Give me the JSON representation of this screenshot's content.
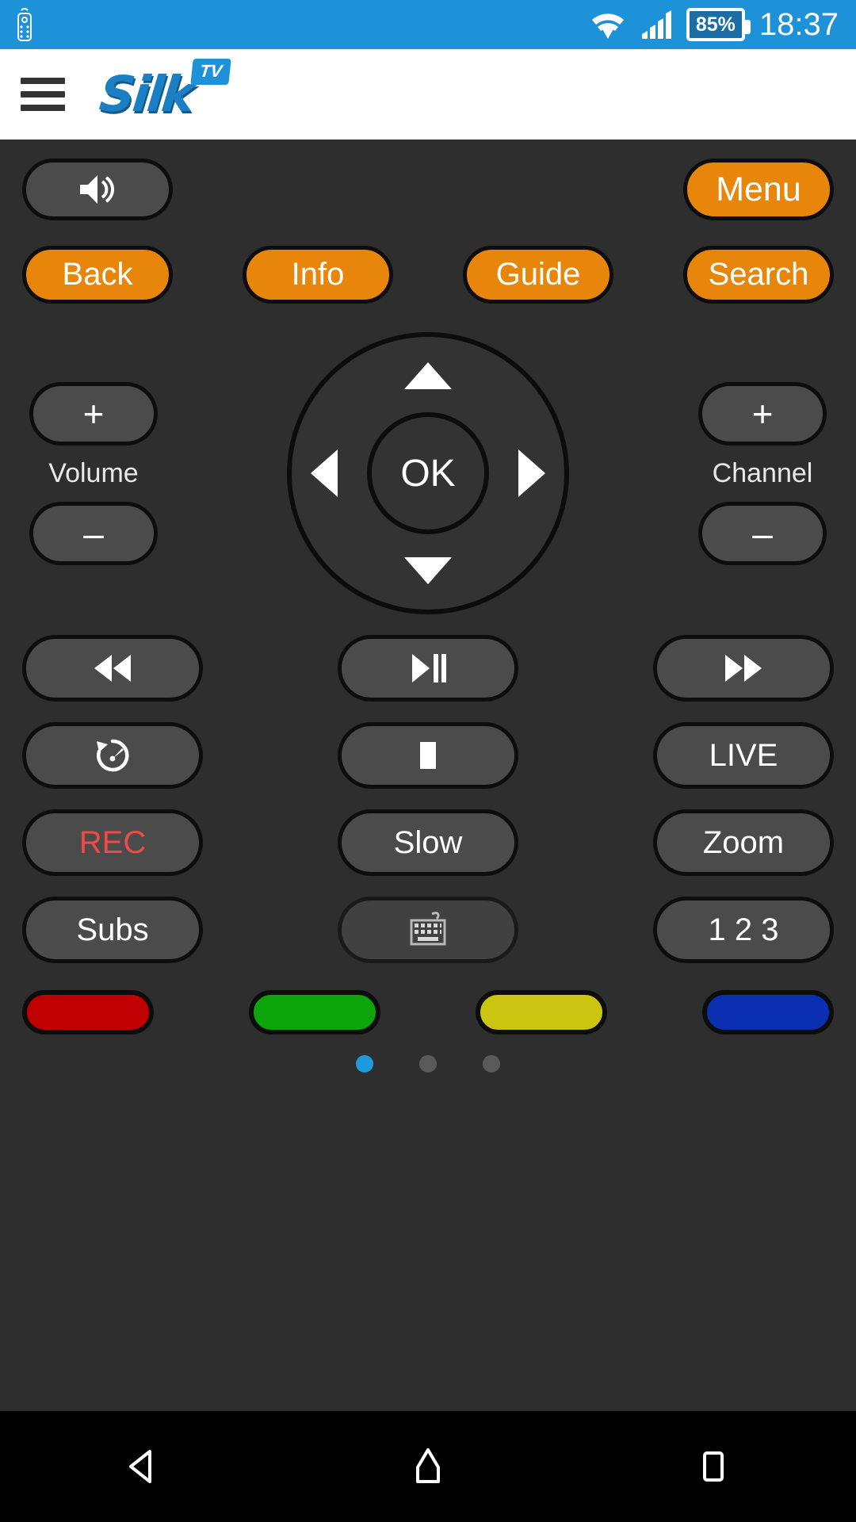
{
  "status_bar": {
    "left_icon": "remote-control-icon",
    "wifi_icon": "wifi-icon",
    "signal_icon": "cellular-signal-icon",
    "battery_level": "85%",
    "time": "18:37",
    "background_color": "#1e92d8"
  },
  "app_bar": {
    "menu_icon": "hamburger-menu-icon",
    "logo_text": "Silk",
    "logo_badge": "TV",
    "brand_color": "#1b7fc4"
  },
  "remote": {
    "mute": {
      "icon": "volume-speaker-icon",
      "label": ""
    },
    "menu": {
      "label": "Menu"
    },
    "quad_row": [
      {
        "label": "Back"
      },
      {
        "label": "Info"
      },
      {
        "label": "Guide"
      },
      {
        "label": "Search"
      }
    ],
    "volume": {
      "label": "Volume",
      "up": "+",
      "down": "–"
    },
    "channel": {
      "label": "Channel",
      "up": "+",
      "down": "–"
    },
    "dpad": {
      "ok": "OK",
      "up_icon": "arrow-up-icon",
      "down_icon": "arrow-down-icon",
      "left_icon": "arrow-left-icon",
      "right_icon": "arrow-right-icon"
    },
    "transport_row_1": [
      {
        "name": "rewind",
        "icon": "rewind-icon",
        "label": ""
      },
      {
        "name": "play-pause",
        "icon": "play-pause-icon",
        "label": ""
      },
      {
        "name": "fast-forward",
        "icon": "fast-forward-icon",
        "label": ""
      }
    ],
    "transport_row_2": [
      {
        "name": "replay",
        "icon": "replay-icon",
        "label": ""
      },
      {
        "name": "stop",
        "icon": "stop-icon",
        "label": ""
      },
      {
        "name": "live",
        "icon": "",
        "label": "LIVE"
      }
    ],
    "transport_row_3": [
      {
        "name": "record",
        "icon": "",
        "label": "REC",
        "color": "#ef4b45"
      },
      {
        "name": "slow",
        "icon": "",
        "label": "Slow"
      },
      {
        "name": "zoom",
        "icon": "",
        "label": "Zoom"
      }
    ],
    "transport_row_4": [
      {
        "name": "subs",
        "icon": "",
        "label": "Subs"
      },
      {
        "name": "keyboard",
        "icon": "keyboard-icon",
        "label": "",
        "disabled": true
      },
      {
        "name": "numbers",
        "icon": "",
        "label": "1 2 3"
      }
    ],
    "color_buttons": [
      {
        "name": "red",
        "color": "#c00000"
      },
      {
        "name": "green",
        "color": "#0ba50b"
      },
      {
        "name": "yellow",
        "color": "#cbc410"
      },
      {
        "name": "blue",
        "color": "#0a2fb0"
      }
    ],
    "page_dots": {
      "count": 3,
      "active_index": 0,
      "active_color": "#1e9adf"
    }
  },
  "nav_bar": {
    "back_icon": "nav-back-icon",
    "home_icon": "nav-home-icon",
    "recents_icon": "nav-recents-icon"
  }
}
